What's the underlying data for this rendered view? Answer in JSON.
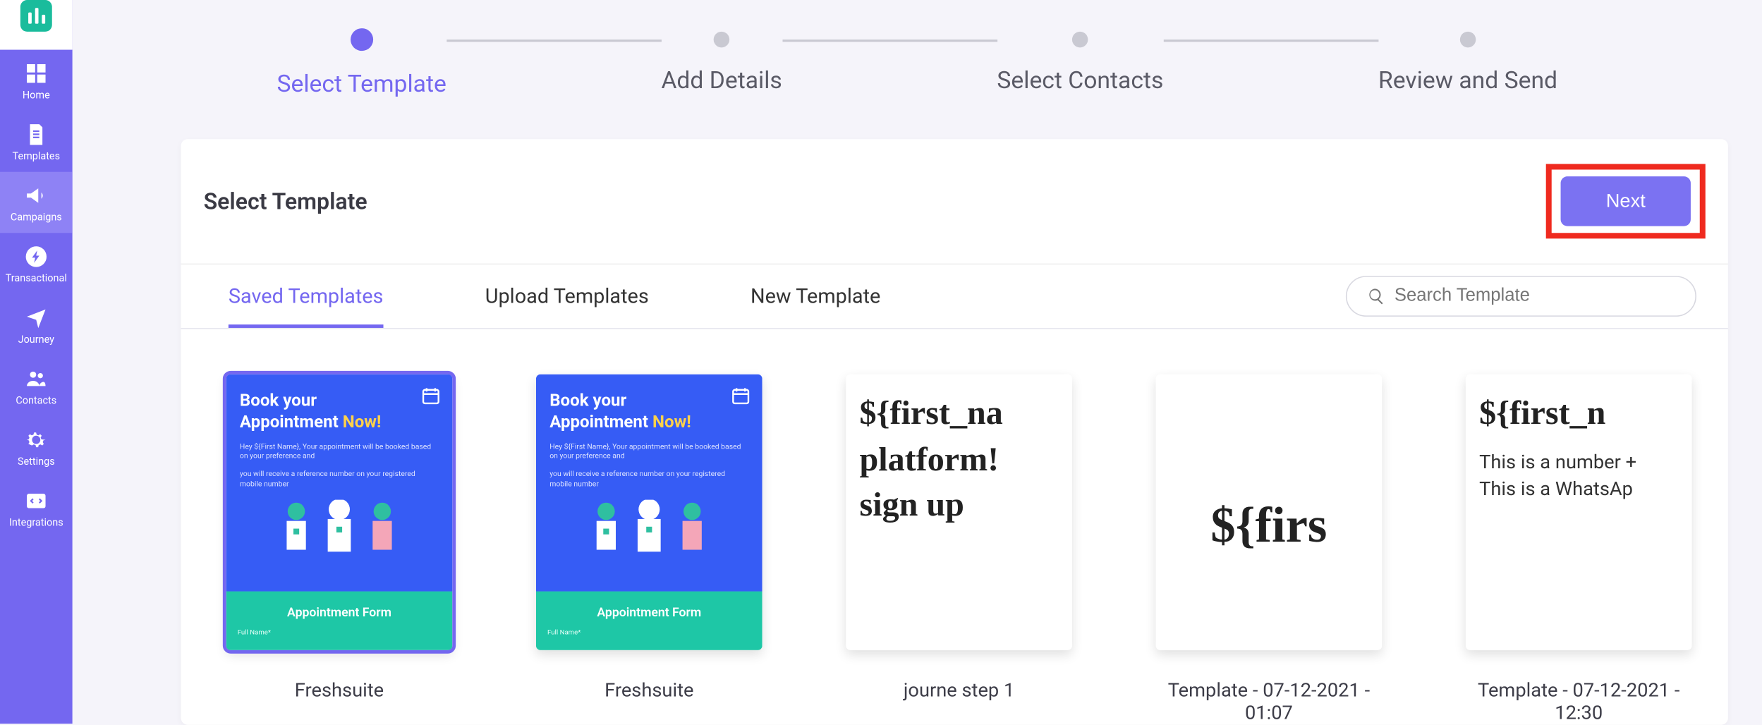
{
  "sidebar": {
    "items": [
      {
        "label": "Home"
      },
      {
        "label": "Templates"
      },
      {
        "label": "Campaigns"
      },
      {
        "label": "Transactional"
      },
      {
        "label": "Journey"
      },
      {
        "label": "Contacts"
      },
      {
        "label": "Settings"
      },
      {
        "label": "Integrations"
      }
    ]
  },
  "stepper": {
    "steps": [
      {
        "label": "Select Template",
        "active": true
      },
      {
        "label": "Add Details"
      },
      {
        "label": "Select Contacts"
      },
      {
        "label": "Review and Send"
      }
    ]
  },
  "card": {
    "title": "Select Template",
    "next_label": "Next"
  },
  "tabs": {
    "items": [
      {
        "label": "Saved Templates",
        "active": true
      },
      {
        "label": "Upload Templates"
      },
      {
        "label": "New Template"
      }
    ],
    "search_placeholder": "Search Template"
  },
  "templates": [
    {
      "name": "Freshsuite",
      "kind": "appointment",
      "selected": true,
      "heading_l1": "Book your",
      "heading_l2a": "Appointment ",
      "heading_l2b": "Now!",
      "sub1": "Hey ${First Name}, Your appointment will be booked based on your preference and",
      "sub2": "you will receive a reference number on your registered mobile number",
      "footer_title": "Appointment Form",
      "footer_sub": "Full Name*"
    },
    {
      "name": "Freshsuite",
      "kind": "appointment",
      "heading_l1": "Book your",
      "heading_l2a": "Appointment ",
      "heading_l2b": "Now!",
      "sub1": "Hey ${First Name}, Your appointment will be booked based on your preference and",
      "sub2": "you will receive a reference number on your registered mobile number",
      "footer_title": "Appointment Form",
      "footer_sub": "Full Name*"
    },
    {
      "name": "journe step 1",
      "kind": "text",
      "line1": "${first_na",
      "line2": "platform!",
      "line3": "sign up"
    },
    {
      "name": "Template - 07-12-2021 - 01:07",
      "kind": "bigtext",
      "big": "${firs"
    },
    {
      "name": "Template - 07-12-2021 - 12:30",
      "kind": "mixed",
      "line1": "${first_n",
      "line2": "This is a number +",
      "line3": "This is a WhatsAp"
    }
  ]
}
